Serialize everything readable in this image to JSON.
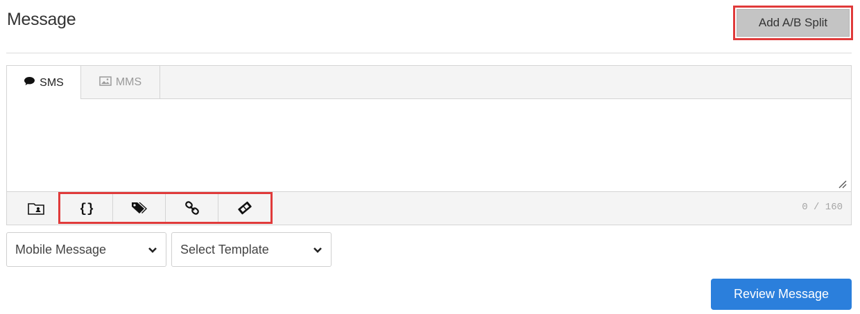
{
  "header": {
    "title": "Message",
    "ab_split_label": "Add A/B Split"
  },
  "tabs": [
    {
      "label": "SMS",
      "icon": "chat-bubble-icon",
      "active": true
    },
    {
      "label": "MMS",
      "icon": "image-icon",
      "active": false
    }
  ],
  "editor": {
    "value": "",
    "counter": "0 / 160"
  },
  "toolbar": {
    "icons": [
      "contact-card-icon",
      "curly-braces-icon",
      "tags-icon",
      "link-icon",
      "coupon-icon"
    ]
  },
  "selects": {
    "message_type": "Mobile Message",
    "template": "Select Template"
  },
  "actions": {
    "review_label": "Review Message"
  },
  "colors": {
    "primary": "#2b7fdc",
    "highlight": "#e03a3a",
    "secondary_button": "#c4c4c4"
  }
}
